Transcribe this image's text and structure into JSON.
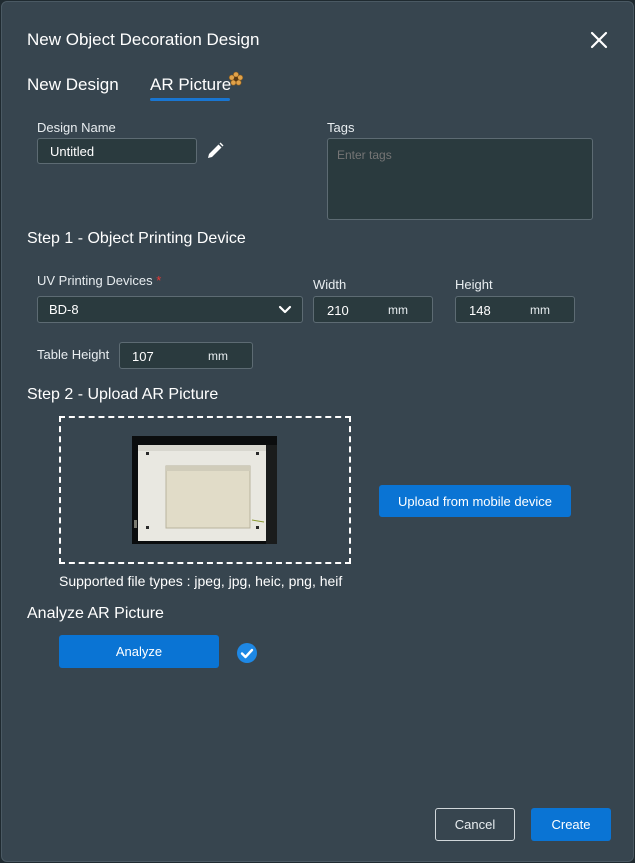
{
  "dialog": {
    "title": "New Object Decoration Design",
    "close_icon": "close-icon"
  },
  "tabs": [
    {
      "label": "New Design",
      "active": false
    },
    {
      "label": "AR Picture",
      "active": true,
      "badge_icon": "flower-badge-icon"
    }
  ],
  "design_name": {
    "label": "Design Name",
    "value": "Untitled",
    "edit_icon": "pencil-icon"
  },
  "tags": {
    "label": "Tags",
    "placeholder": "Enter tags"
  },
  "step1": {
    "title": "Step 1 - Object Printing Device",
    "device": {
      "label": "UV Printing Devices",
      "required_mark": "*",
      "value": "BD-8",
      "chevron_icon": "chevron-down-icon"
    },
    "width": {
      "label": "Width",
      "value": "210",
      "unit": "mm"
    },
    "height": {
      "label": "Height",
      "value": "148",
      "unit": "mm"
    },
    "table_height": {
      "label": "Table Height",
      "value": "107",
      "unit": "mm"
    }
  },
  "step2": {
    "title": "Step 2 - Upload AR Picture",
    "supported_types": "Supported file types : jpeg, jpg, heic, png, heif",
    "upload_button": "Upload from mobile device"
  },
  "analyze": {
    "title": "Analyze AR Picture",
    "button": "Analyze",
    "status_icon": "check-circle-icon"
  },
  "footer": {
    "cancel": "Cancel",
    "create": "Create"
  },
  "colors": {
    "background": "#37454f",
    "input_bg": "#2a3a3e",
    "accent": "#0a74d4",
    "required": "#e53935"
  }
}
